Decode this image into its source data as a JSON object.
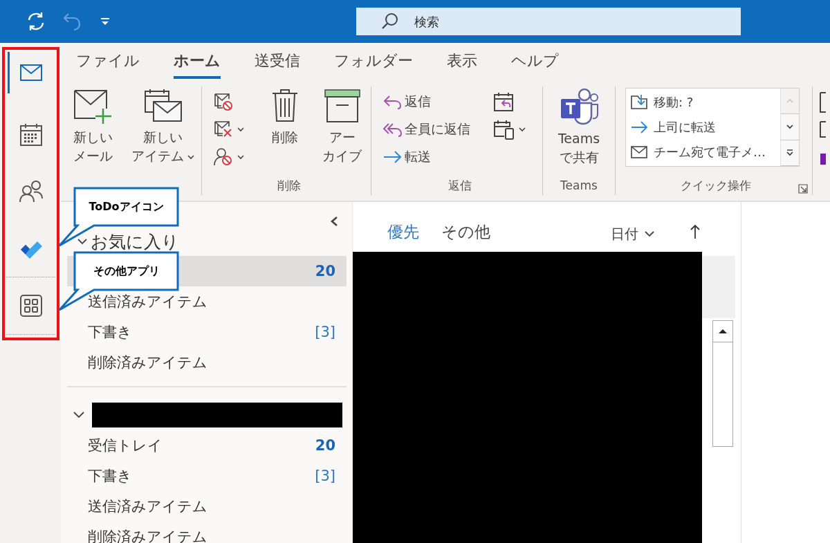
{
  "title_bar": {
    "search": {
      "placeholder": "検索"
    }
  },
  "nav_rail": [
    {
      "kind": "mail",
      "selected": true
    },
    {
      "kind": "calendar",
      "selected": false
    },
    {
      "kind": "people",
      "selected": false
    },
    {
      "kind": "todo",
      "selected": false
    },
    {
      "kind": "apps",
      "selected": false
    }
  ],
  "ribbon": {
    "tabs": [
      {
        "label": "ファイル",
        "selected": false
      },
      {
        "label": "ホーム",
        "selected": true
      },
      {
        "label": "送受信",
        "selected": false
      },
      {
        "label": "フォルダー",
        "selected": false
      },
      {
        "label": "表示",
        "selected": false
      },
      {
        "label": "ヘルプ",
        "selected": false
      }
    ],
    "groups": [
      {
        "items": [
          {
            "kind": "large",
            "label_lines": [
              "新しい",
              "メール"
            ],
            "dropdown": false
          },
          {
            "kind": "large",
            "label_lines": [
              "新しい",
              "アイテム"
            ],
            "dropdown": true
          }
        ]
      },
      {
        "label": "削除",
        "items": [
          {
            "kind": "icon",
            "dropdown": false
          },
          {
            "kind": "icon",
            "dropdown": true
          },
          {
            "kind": "icon",
            "dropdown": true
          },
          {
            "kind": "large",
            "label_lines": [
              "削除"
            ],
            "dropdown": false
          },
          {
            "kind": "large",
            "label_lines": [
              "アー",
              "カイブ"
            ],
            "dropdown": false
          }
        ]
      },
      {
        "label": "返信",
        "items": [
          {
            "kind": "small",
            "label": "返信",
            "dropdown": false
          },
          {
            "kind": "small",
            "label": "全員に返信",
            "dropdown": false
          },
          {
            "kind": "small",
            "label": "転送",
            "dropdown": false
          },
          {
            "kind": "icon",
            "dropdown": false
          },
          {
            "kind": "icon",
            "dropdown": true
          }
        ]
      },
      {
        "label": "Teams",
        "items": [
          {
            "kind": "large",
            "label_lines": [
              "Teams",
              "で共有"
            ],
            "dropdown": false
          }
        ]
      },
      {
        "label": "クイック操作",
        "launcher": true,
        "gallery": {
          "entries": [
            {
              "label": "移動: ?"
            },
            {
              "label": "上司に転送"
            },
            {
              "label": "チーム宛て電子メ…"
            }
          ]
        }
      }
    ]
  },
  "callouts": [
    {
      "text": "ToDoアイコン"
    },
    {
      "text": "その他アプリ"
    }
  ],
  "folder_pane": {
    "favorites": {
      "title": "お気に入り",
      "expanded": true,
      "folders": [
        {
          "count": "20",
          "unread": true,
          "selected": true
        },
        {
          "name": "送信済みアイテム",
          "selected": false
        },
        {
          "name": "下書き",
          "count": "[3]",
          "unread": false,
          "selected": false
        },
        {
          "name": "削除済みアイテム",
          "selected": false
        }
      ]
    },
    "account": {
      "expanded": true,
      "folders": [
        {
          "name": "受信トレイ",
          "count": "20",
          "unread": true,
          "selected": false
        },
        {
          "name": "下書き",
          "count": "[3]",
          "unread": false,
          "selected": false
        },
        {
          "name": "送信済みアイテム",
          "selected": false
        },
        {
          "name": "削除済みアイテム",
          "selected": false
        }
      ]
    }
  },
  "message_list": {
    "tabs": [
      {
        "label": "優先",
        "selected": true
      },
      {
        "label": "その他",
        "selected": false
      }
    ],
    "sort": {
      "label": "日付"
    }
  }
}
